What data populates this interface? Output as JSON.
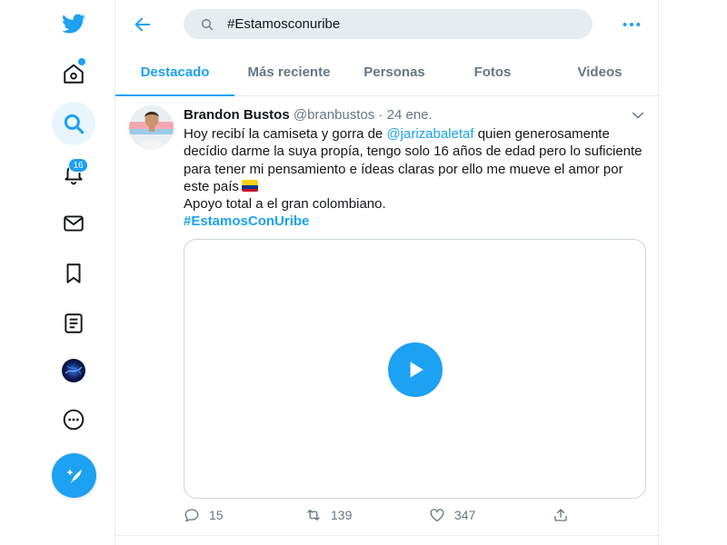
{
  "search": {
    "value": "#Estamosconuribe"
  },
  "notifications": {
    "badge": "16"
  },
  "tabs": [
    {
      "label": "Destacado",
      "active": true
    },
    {
      "label": "Más reciente"
    },
    {
      "label": "Personas"
    },
    {
      "label": "Fotos"
    },
    {
      "label": "Videos"
    }
  ],
  "tweet": {
    "author_name": "Brandon Bustos",
    "author_handle": "@branbustos",
    "separator": "·",
    "date": "24 ene.",
    "text_part1": "Hoy recibí la camiseta y gorra de ",
    "mention": "@jarizabaletaf",
    "text_part2": " quien generosamente decídio darme la suya propía, tengo solo 16 años de edad pero lo suficiente para tener mi pensamiento e ídeas claras por ello me mueve el amor por este país",
    "line2": "Apoyo total a el gran colombiano.",
    "hashtag": "#EstamosConUribe",
    "replies": "15",
    "retweets": "139",
    "likes": "347"
  },
  "icons": {
    "logo": "twitter-bird-icon",
    "home": "home-icon",
    "explore": "search-icon",
    "notifications": "bell-icon",
    "messages": "envelope-icon",
    "bookmarks": "bookmark-icon",
    "lists": "list-icon",
    "profile": "avatar",
    "more": "more-circle-icon",
    "compose": "compose-feather-icon"
  },
  "colors": {
    "accent": "#1da1f2",
    "text": "#14171a",
    "secondary": "#657786",
    "border": "#e6ecf0"
  }
}
